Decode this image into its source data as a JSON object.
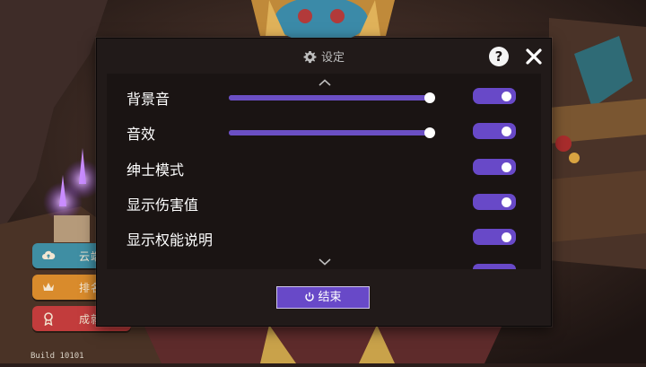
{
  "background": {
    "side_buttons": [
      {
        "label": "云端",
        "icon": "cloud-icon",
        "color": "#3f8ea3"
      },
      {
        "label": "排名",
        "icon": "crown-icon",
        "color": "#d98b2c"
      },
      {
        "label": "成就",
        "icon": "medal-icon",
        "color": "#c23c3c"
      }
    ],
    "build_label": "Build 10101"
  },
  "dialog": {
    "title": "设定",
    "title_icon": "gear-icon",
    "help_label": "?",
    "close_icon": "close-icon",
    "accent_color": "#6849c8",
    "settings": [
      {
        "label": "背景音",
        "slider_value": 1.0,
        "enabled": true
      },
      {
        "label": "音效",
        "slider_value": 1.0,
        "enabled": true
      },
      {
        "label": "绅士模式",
        "enabled": true
      },
      {
        "label": "显示伤害值",
        "enabled": true
      },
      {
        "label": "显示权能说明",
        "enabled": true
      }
    ],
    "end_button_label": "结束",
    "end_button_icon": "power-icon"
  }
}
